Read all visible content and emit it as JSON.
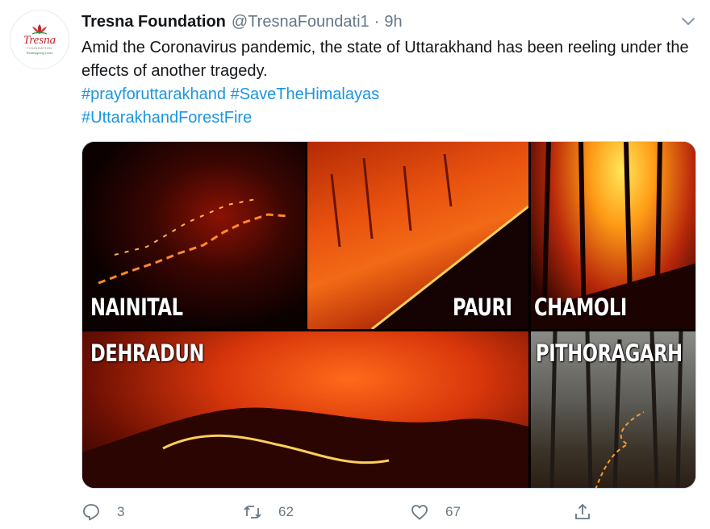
{
  "tweet": {
    "author_name": "Tresna Foundation",
    "handle": "@TresnaFoundati1",
    "separator": "·",
    "time": "9h",
    "text": "Amid the Coronavirus pandemic, the state of Uttarakhand has been reeling under the effects of another tragedy.",
    "hashtags": [
      "#prayforuttarakhand",
      "#SaveTheHimalayas",
      "#UttarakhandForestFire"
    ]
  },
  "avatar": {
    "logo_word": "Tresna",
    "logo_sub": "FOUNDATION",
    "logo_tag": "Redesigning Lives"
  },
  "media": {
    "labels": [
      "NAINITAL",
      "PAURI",
      "CHAMOLI",
      "DEHRADUN",
      "PITHORAGARH"
    ]
  },
  "actions": {
    "replies": "3",
    "retweets": "62",
    "likes": "67"
  },
  "icons": [
    "chevron-down-icon",
    "reply-icon",
    "retweet-icon",
    "like-icon",
    "share-icon"
  ],
  "colors": {
    "link": "#1b95e0",
    "secondary_text": "#657786",
    "primary_text": "#14171a"
  }
}
